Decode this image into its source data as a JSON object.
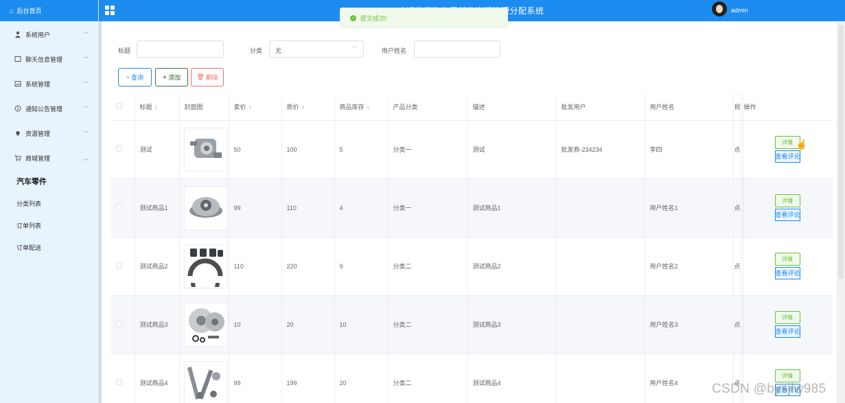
{
  "header": {
    "title": "欢迎使用汽车零部件资源管理分配系统",
    "user": "admin"
  },
  "toast": {
    "message": "提交成功!"
  },
  "sidebar": {
    "home": "后台首页",
    "items": [
      {
        "label": "系统用户",
        "icon": "user-icon"
      },
      {
        "label": "聊天信息管理",
        "icon": "chat-icon"
      },
      {
        "label": "系统管理",
        "icon": "image-icon"
      },
      {
        "label": "通知公告管理",
        "icon": "info-icon"
      },
      {
        "label": "资源管理",
        "icon": "location-icon"
      },
      {
        "label": "商城管理",
        "icon": "cart-icon"
      }
    ],
    "sub_items": [
      "汽车零件",
      "分类列表",
      "订单列表",
      "订单配送"
    ]
  },
  "filters": {
    "title_label": "标题",
    "category_label": "分类",
    "category_value": "无",
    "username_label": "用户姓名"
  },
  "buttons": {
    "query": "查询",
    "add": "添加",
    "delete": "删除"
  },
  "table": {
    "columns": [
      "标题",
      "封面图",
      "卖价",
      "质价",
      "商品库存",
      "产品分类",
      "描述",
      "批发用户",
      "用户姓名",
      "视",
      "操作"
    ],
    "detail_label": "详情",
    "review_label": "查看评论",
    "rows": [
      {
        "title": "测试",
        "price": "50",
        "cost": "100",
        "stock": "5",
        "category": "分类一",
        "desc": "测试",
        "wholesaler": "批发商-234234",
        "username": "李四",
        "extra": "点"
      },
      {
        "title": "测试商品1",
        "price": "99",
        "cost": "110",
        "stock": "4",
        "category": "分类一",
        "desc": "测试商品1",
        "wholesaler": "",
        "username": "用户姓名1",
        "extra": "点"
      },
      {
        "title": "测试商品2",
        "price": "110",
        "cost": "220",
        "stock": "9",
        "category": "分类二",
        "desc": "测试商品2",
        "wholesaler": "",
        "username": "用户姓名2",
        "extra": "点"
      },
      {
        "title": "测试商品3",
        "price": "10",
        "cost": "20",
        "stock": "10",
        "category": "分类二",
        "desc": "测试商品3",
        "wholesaler": "",
        "username": "用户姓名3",
        "extra": "点"
      },
      {
        "title": "测试商品4",
        "price": "99",
        "cost": "199",
        "stock": "20",
        "category": "分类二",
        "desc": "测试商品4",
        "wholesaler": "",
        "username": "用户姓名4",
        "extra": "点"
      }
    ]
  },
  "watermark": "CSDN @bysjlw985"
}
